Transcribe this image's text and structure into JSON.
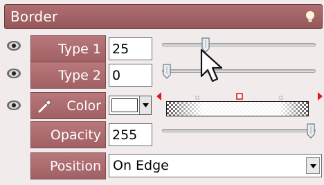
{
  "panel": {
    "title": "Border"
  },
  "rows": {
    "type1": {
      "label": "Type 1",
      "value": "25",
      "slider_level": 0.27
    },
    "type2": {
      "label": "Type 2",
      "value": "0",
      "slider_level": 0.0
    },
    "color": {
      "label": "Color",
      "swatch_color": "#ffffff"
    },
    "opacity": {
      "label": "Opacity",
      "value": "255",
      "slider_level": 1.0
    },
    "position": {
      "label": "Position",
      "value": "On Edge"
    }
  },
  "colors": {
    "label_bg": "#a86669",
    "header_bg": "#a36366",
    "panel_bg": "#f1ebec",
    "stop_marker_red": "#e0181b"
  },
  "icons": [
    "lightbulb-icon",
    "eye-icon",
    "eyedropper-icon",
    "dropdown-arrow-icon",
    "mouse-cursor-icon"
  ]
}
